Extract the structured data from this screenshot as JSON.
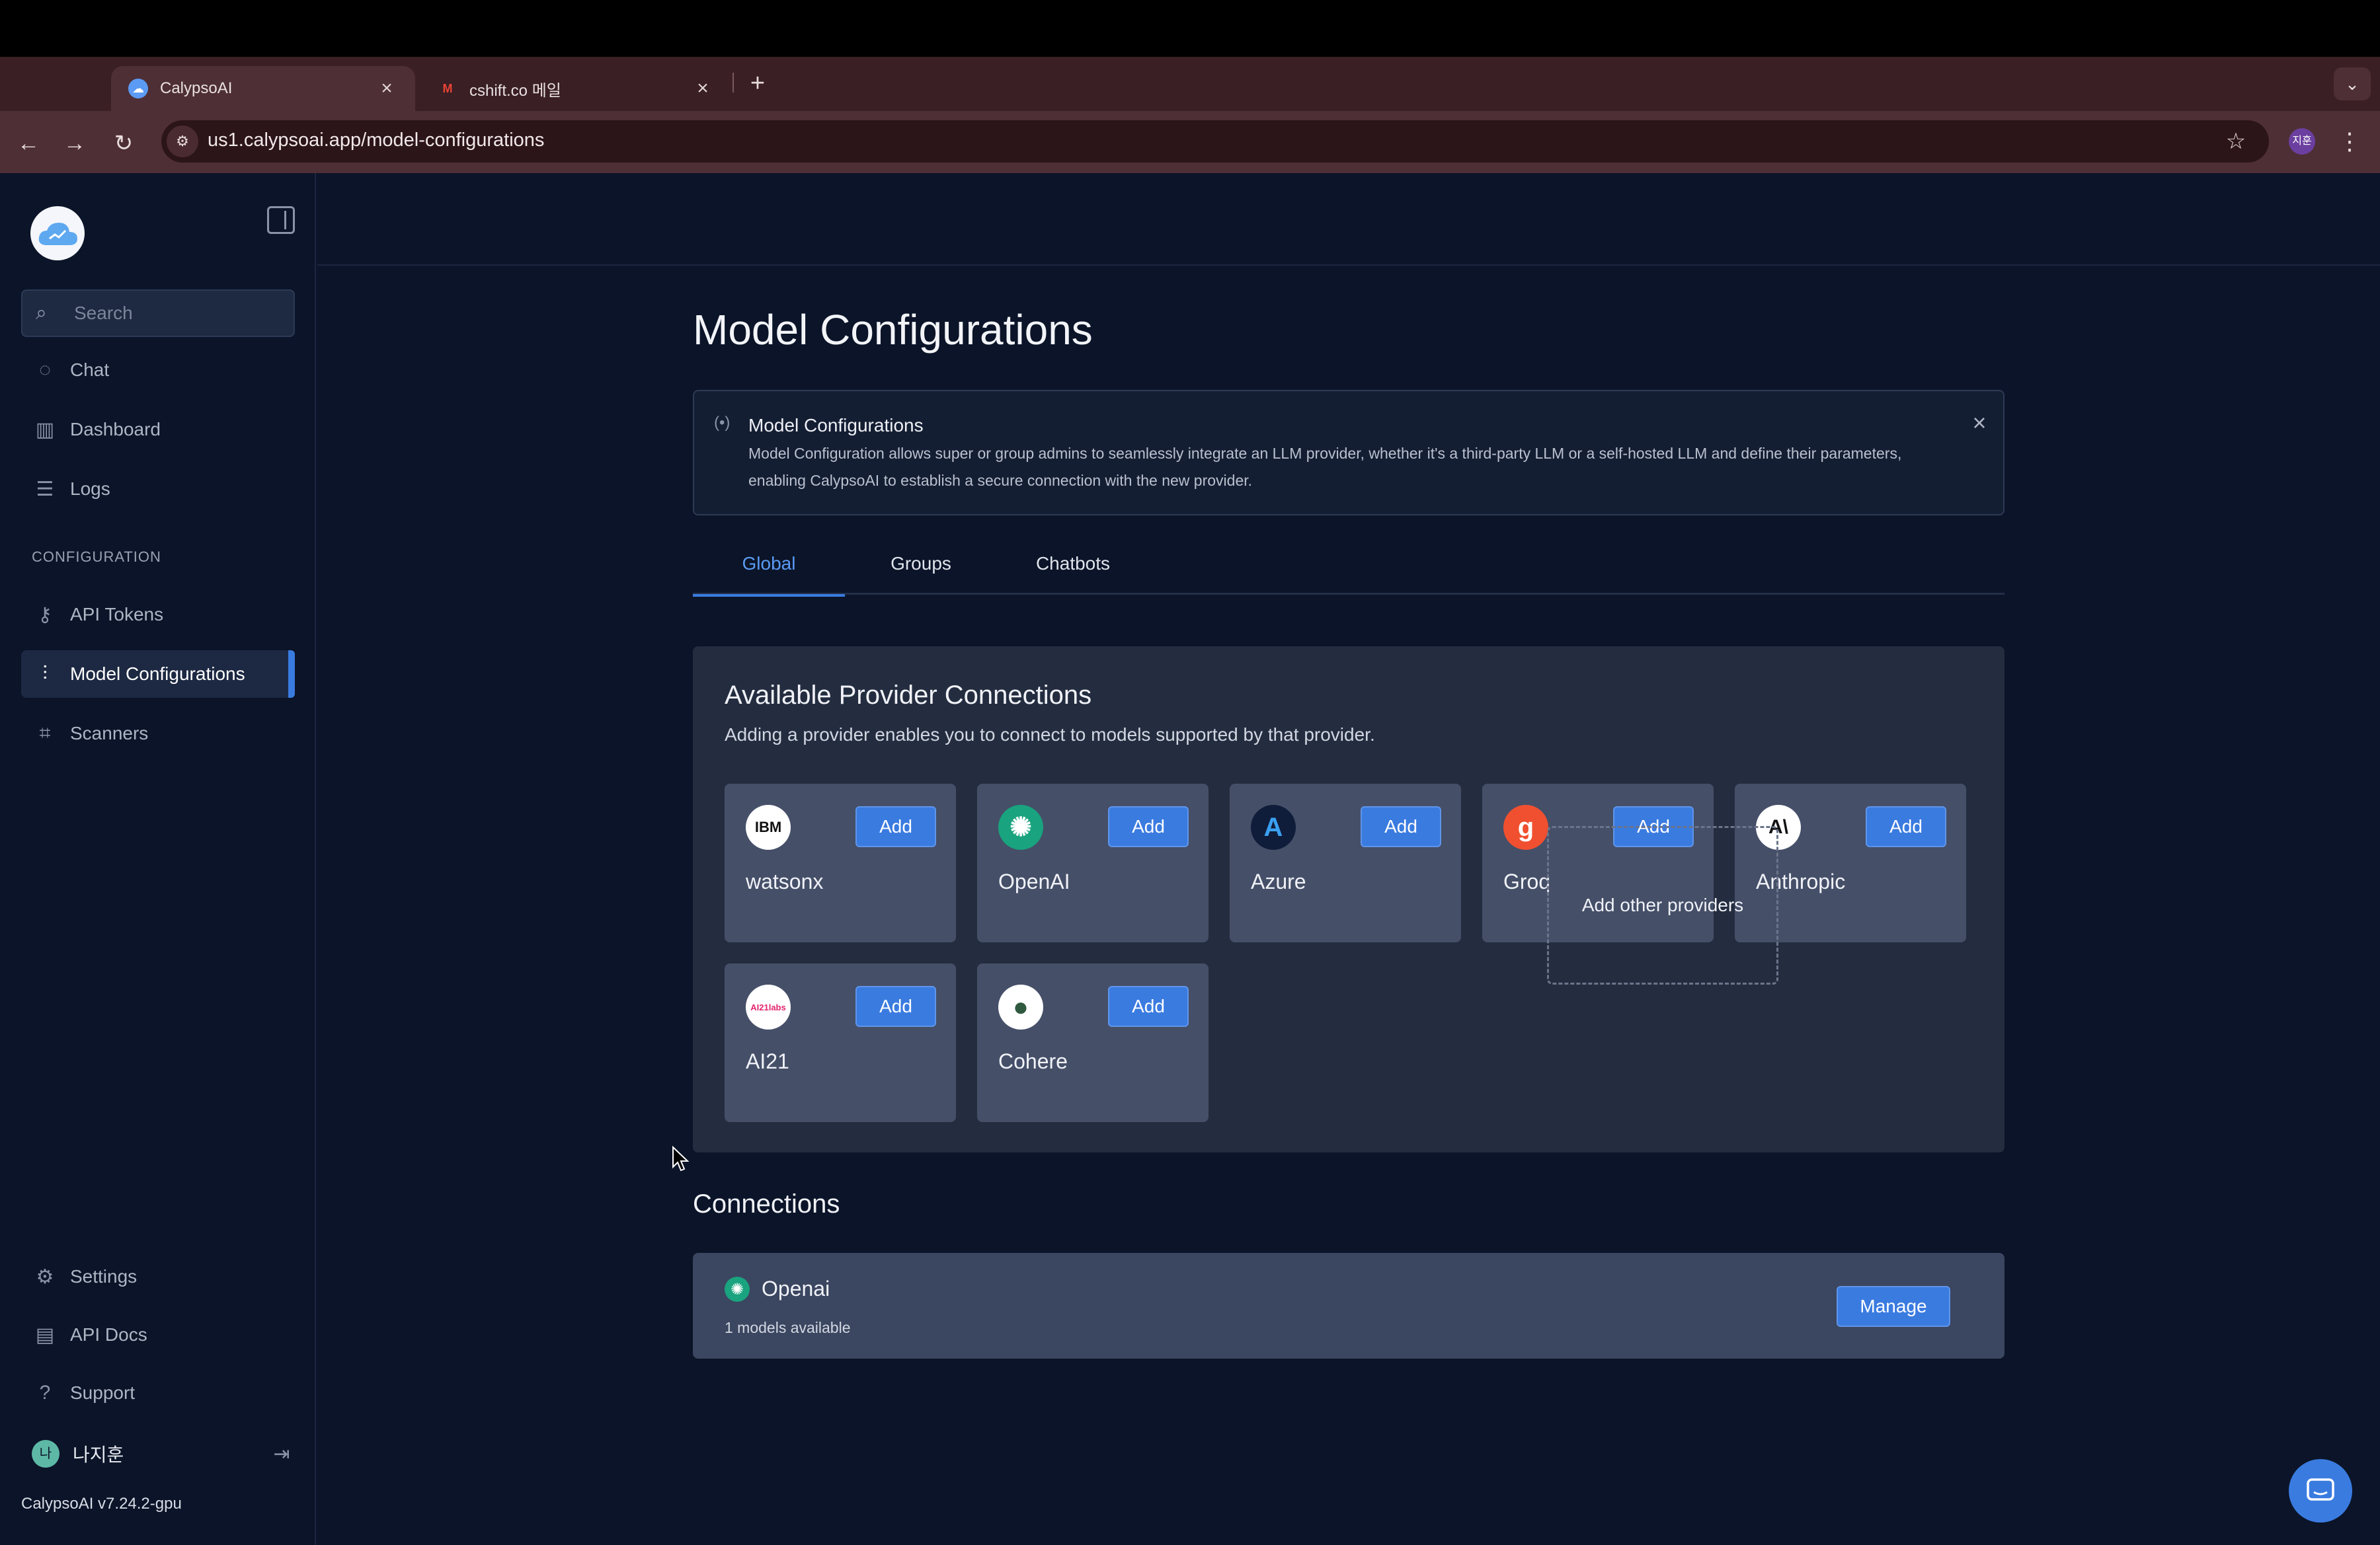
{
  "browser": {
    "tabs": [
      {
        "title": "CalypsoAI",
        "favicon": "calypso-cloud-icon",
        "active": true
      },
      {
        "title": "cshift.co 메일",
        "favicon": "gmail-icon",
        "active": false
      }
    ],
    "tab_close_glyph": "×",
    "new_tab_glyph": "+",
    "tab_menu_glyph": "⌄",
    "back_glyph": "←",
    "forward_glyph": "→",
    "reload_glyph": "↻",
    "site_info_glyph": "⚙",
    "url_host": "us1.calypsoai.app",
    "url_path": "/model-configurations",
    "star_glyph": "☆",
    "profile_initials": "지훈",
    "menu_glyph": "⋮"
  },
  "sidebar": {
    "search_placeholder": "Search",
    "items": [
      {
        "label": "Chat",
        "icon": "chat-icon",
        "glyph": "◌"
      },
      {
        "label": "Dashboard",
        "icon": "bar-chart-icon",
        "glyph": "▥"
      },
      {
        "label": "Logs",
        "icon": "logs-icon",
        "glyph": "☰"
      }
    ],
    "config_header": "CONFIGURATION",
    "config_items": [
      {
        "label": "API Tokens",
        "icon": "key-icon",
        "glyph": "⚷"
      },
      {
        "label": "Model Configurations",
        "icon": "sliders-icon",
        "glyph": "⫶",
        "active": true
      },
      {
        "label": "Scanners",
        "icon": "scan-icon",
        "glyph": "⌗"
      }
    ],
    "bottom_items": [
      {
        "label": "Settings",
        "icon": "gear-icon",
        "glyph": "⚙"
      },
      {
        "label": "API Docs",
        "icon": "book-icon",
        "glyph": "▤"
      },
      {
        "label": "Support",
        "icon": "help-circle-icon",
        "glyph": "?"
      }
    ],
    "user": {
      "initial": "나",
      "name": "나지훈",
      "logout_glyph": "⇥"
    },
    "version": "CalypsoAI v7.24.2-gpu"
  },
  "main": {
    "title": "Model Configurations",
    "banner": {
      "icon_glyph": "(•)",
      "title": "Model Configurations",
      "text": "Model Configuration allows super or group admins to seamlessly integrate an LLM provider, whether it's a third-party LLM or a self-hosted LLM and define their parameters, enabling CalypsoAI to establish a secure connection with the new provider.",
      "close_glyph": "×"
    },
    "tabs": [
      {
        "label": "Global",
        "active": true
      },
      {
        "label": "Groups"
      },
      {
        "label": "Chatbots"
      }
    ],
    "providers": {
      "title": "Available Provider Connections",
      "subtitle": "Adding a provider enables you to connect to models supported by that provider.",
      "add_label": "Add",
      "items": [
        {
          "name": "watsonx",
          "logo_text": "IBM",
          "logo_bg": "#ffffff",
          "logo_fg": "#111111"
        },
        {
          "name": "OpenAI",
          "logo_text": "✺",
          "logo_bg": "#19a37e",
          "logo_fg": "#ffffff"
        },
        {
          "name": "Azure",
          "logo_text": "A",
          "logo_bg": "#0f1c3a",
          "logo_fg": "#3aa0f0"
        },
        {
          "name": "Groq",
          "logo_text": "g",
          "logo_bg": "#f0502f",
          "logo_fg": "#ffffff"
        },
        {
          "name": "Anthropic",
          "logo_text": "A\\",
          "logo_bg": "#ffffff",
          "logo_fg": "#111111"
        },
        {
          "name": "AI21",
          "logo_text": "AI21labs",
          "logo_bg": "#ffffff",
          "logo_fg": "#e2246f"
        },
        {
          "name": "Cohere",
          "logo_text": "●",
          "logo_bg": "#ffffff",
          "logo_fg": "#2f5a3f"
        }
      ],
      "add_other_label": "Add other providers"
    },
    "connections": {
      "title": "Connections",
      "items": [
        {
          "name": "Openai",
          "logo_glyph": "✺",
          "models_text": "1 models available",
          "manage_label": "Manage"
        }
      ]
    }
  },
  "colors": {
    "accent": "#3a7be0",
    "app_bg": "#0b1428",
    "panel_bg": "#242d40",
    "card_bg": "#454f68"
  }
}
